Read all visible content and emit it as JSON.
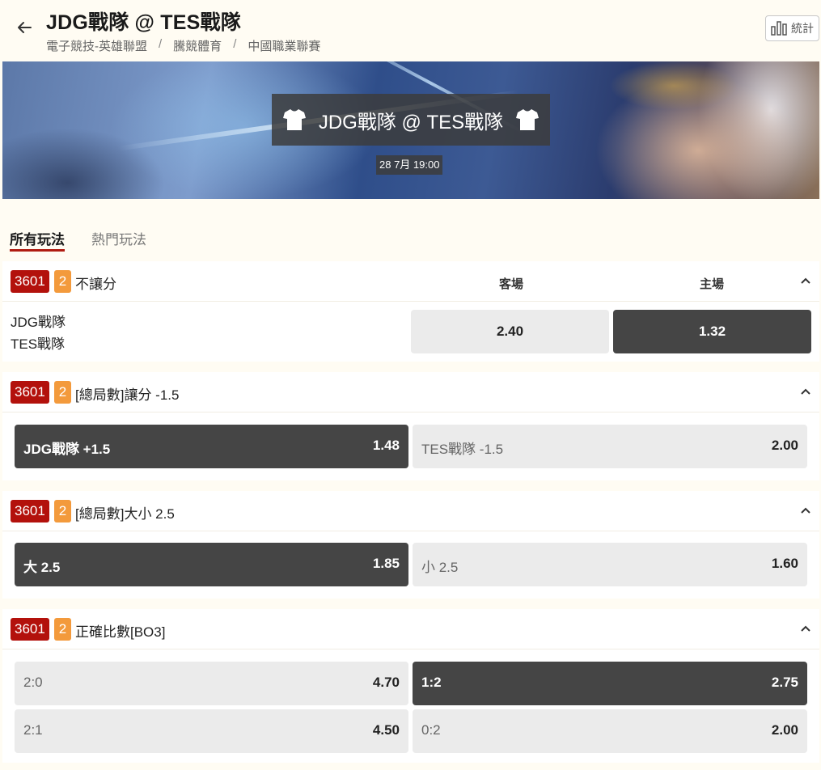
{
  "header": {
    "title": "JDG戰隊 @ TES戰隊",
    "breadcrumb": [
      "電子競技-英雄聯盟",
      "騰競體育",
      "中國職業聯賽"
    ],
    "stats_label": "統計"
  },
  "banner": {
    "match": "JDG戰隊 @ TES戰隊",
    "time": "28 7月 19:00"
  },
  "tabs": [
    "所有玩法",
    "熱門玩法"
  ],
  "markets": [
    {
      "code": "3601",
      "count": "2",
      "title": "不讓分",
      "col_away": "客場",
      "col_home": "主場",
      "teams": [
        "JDG戰隊",
        "TES戰隊"
      ],
      "odds": [
        {
          "label": "",
          "value": "2.40",
          "selected": false
        },
        {
          "label": "",
          "value": "1.32",
          "selected": true
        }
      ]
    },
    {
      "code": "3601",
      "count": "2",
      "title": "[總局數]讓分 -1.5",
      "odds": [
        {
          "label": "JDG戰隊 +1.5",
          "value": "1.48",
          "selected": true
        },
        {
          "label": "TES戰隊 -1.5",
          "value": "2.00",
          "selected": false
        }
      ]
    },
    {
      "code": "3601",
      "count": "2",
      "title": "[總局數]大小 2.5",
      "odds": [
        {
          "label": "大 2.5",
          "value": "1.85",
          "selected": true
        },
        {
          "label": "小 2.5",
          "value": "1.60",
          "selected": false
        }
      ]
    },
    {
      "code": "3601",
      "count": "2",
      "title": "正確比數[BO3]",
      "odds": [
        {
          "label": "2:0",
          "value": "4.70",
          "selected": false
        },
        {
          "label": "1:2",
          "value": "2.75",
          "selected": true
        },
        {
          "label": "2:1",
          "value": "4.50",
          "selected": false
        },
        {
          "label": "0:2",
          "value": "2.00",
          "selected": false
        }
      ]
    }
  ],
  "colors": {
    "accent_red": "#b3110c",
    "badge_orange": "#f39a3c",
    "selected": "#454545",
    "unselected": "#ebebeb"
  }
}
